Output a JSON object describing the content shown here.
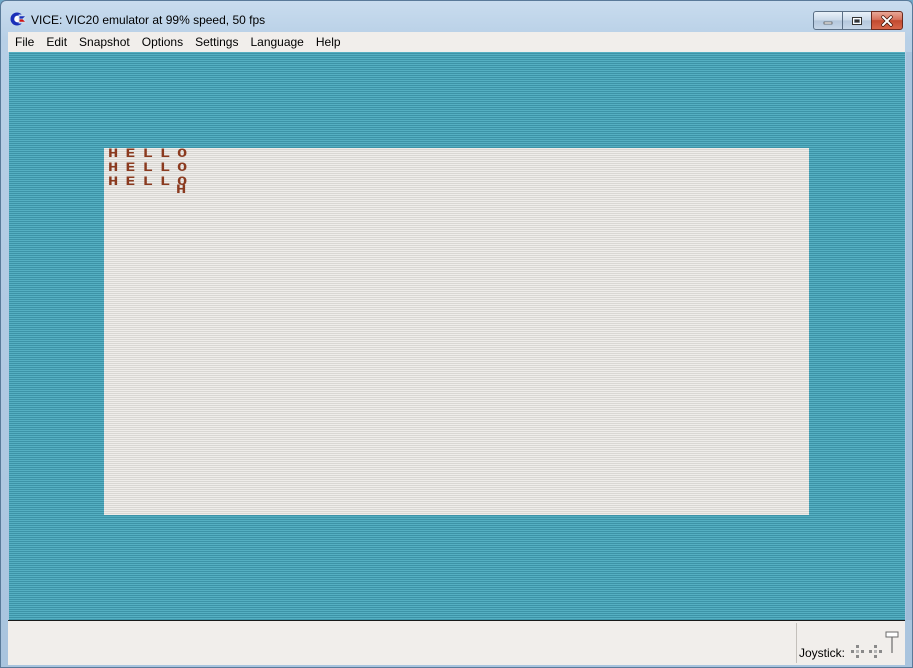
{
  "window": {
    "title": "VICE: VIC20 emulator at 99% speed, 50 fps"
  },
  "menu": {
    "items": [
      "File",
      "Edit",
      "Snapshot",
      "Options",
      "Settings",
      "Language",
      "Help"
    ]
  },
  "screen": {
    "lines": [
      "HELLO",
      "HELLO",
      "HELLO"
    ],
    "stray_char": "H",
    "colors": {
      "border": "#4aa3b7",
      "background": "#e6e4e1",
      "text": "#8b3a1f"
    }
  },
  "status": {
    "joystick_label": "Joystick:"
  },
  "icons": {
    "app": "commodore-icon",
    "minimize": "minimize-icon",
    "maximize": "maximize-icon",
    "close": "close-icon"
  }
}
